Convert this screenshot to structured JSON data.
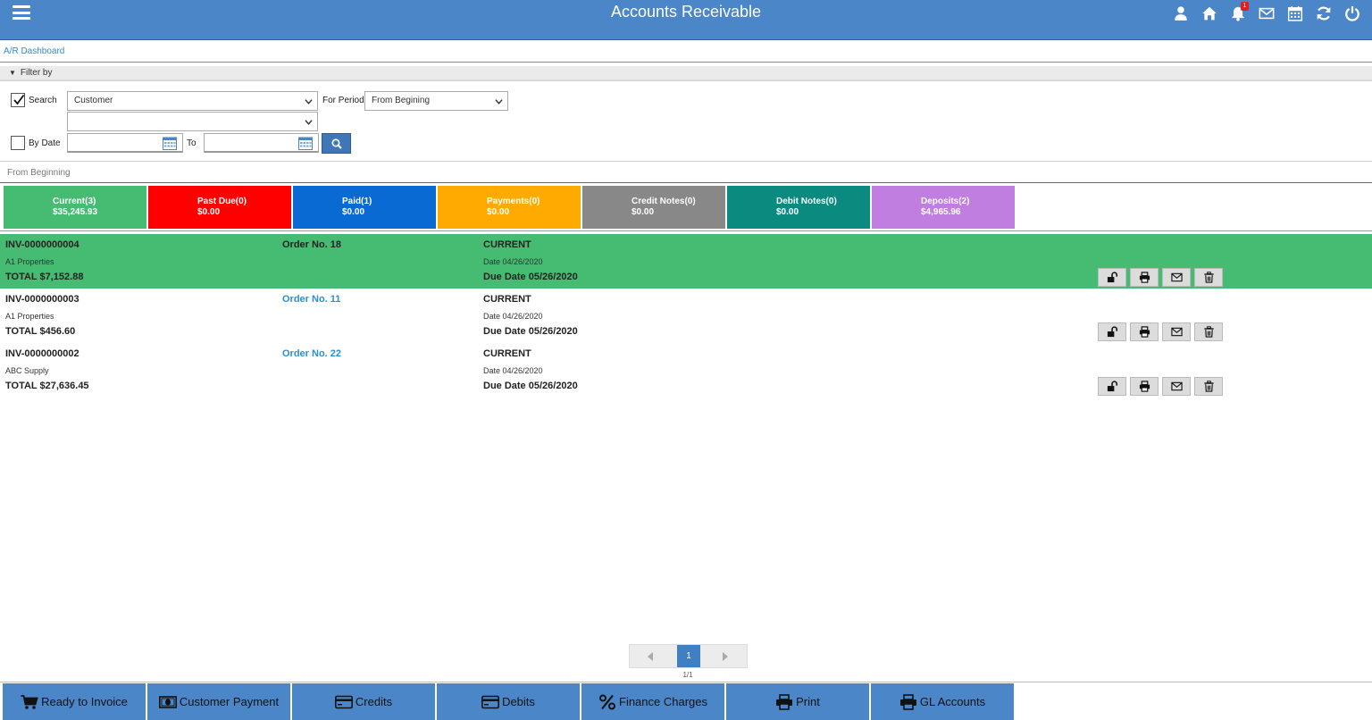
{
  "header": {
    "title": "Accounts Receivable",
    "notification_count": "1",
    "icons": [
      "user-icon",
      "home-icon",
      "bell-icon",
      "mail-icon",
      "calendar-icon",
      "refresh-icon",
      "power-icon"
    ]
  },
  "breadcrumb": "A/R Dashboard",
  "filter": {
    "section_label": "Filter by",
    "search_label": "Search",
    "search_checked": true,
    "search_field_value": "Customer",
    "search_value": "",
    "for_period_label": "For Period",
    "period_value": "From Begining",
    "by_date_label": "By Date",
    "by_date_checked": false,
    "to_label": "To",
    "from_date": "",
    "to_date": ""
  },
  "period_note": "From Beginning",
  "status_cards": [
    {
      "title": "Current(3)",
      "amount": "$35,245.93",
      "color": "#45bc72"
    },
    {
      "title": "Past Due(0)",
      "amount": "$0.00",
      "color": "#ff0000"
    },
    {
      "title": "Paid(1)",
      "amount": "$0.00",
      "color": "#0a6ad3"
    },
    {
      "title": "Payments(0)",
      "amount": "$0.00",
      "color": "#ffaa00"
    },
    {
      "title": "Credit Notes(0)",
      "amount": "$0.00",
      "color": "#888888"
    },
    {
      "title": "Debit Notes(0)",
      "amount": "$0.00",
      "color": "#0b8a80"
    },
    {
      "title": "Deposits(2)",
      "amount": "$4,965.96",
      "color": "#c07ee0"
    }
  ],
  "invoices": [
    {
      "number": "INV-0000000004",
      "customer": "A1 Properties",
      "total": "TOTAL $7,152.88",
      "order": "Order No. 18",
      "status": "CURRENT",
      "date": "Date 04/26/2020",
      "due": "Due Date 05/26/2020",
      "selected": true
    },
    {
      "number": "INV-0000000003",
      "customer": "A1 Properties",
      "total": "TOTAL $456.60",
      "order": "Order No. 11",
      "status": "CURRENT",
      "date": "Date 04/26/2020",
      "due": "Due Date 05/26/2020",
      "selected": false
    },
    {
      "number": "INV-0000000002",
      "customer": "ABC Supply",
      "total": "TOTAL $27,636.45",
      "order": "Order No. 22",
      "status": "CURRENT",
      "date": "Date 04/26/2020",
      "due": "Due Date 05/26/2020",
      "selected": false
    }
  ],
  "pagination": {
    "current": "1",
    "summary": "1/1"
  },
  "bottom_toolbar": [
    {
      "label": "Ready to Invoice",
      "icon": "cart-icon"
    },
    {
      "label": "Customer Payment",
      "icon": "money-icon"
    },
    {
      "label": "Credits",
      "icon": "credit-card-icon"
    },
    {
      "label": "Debits",
      "icon": "credit-card-icon"
    },
    {
      "label": "Finance Charges",
      "icon": "percent-icon"
    },
    {
      "label": "Print",
      "icon": "printer-icon"
    },
    {
      "label": "GL Accounts",
      "icon": "printer-icon"
    }
  ]
}
